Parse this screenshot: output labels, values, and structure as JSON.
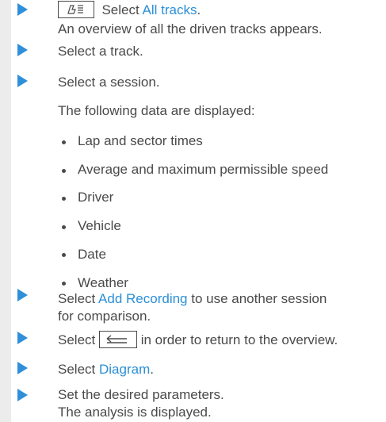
{
  "steps": {
    "s1": {
      "pre": "Select ",
      "link": "All tracks",
      "post": "."
    },
    "s1_result": "An overview of all the driven tracks appears.",
    "s2": "Select a track.",
    "s3": "Select a session.",
    "s3_result": "The following data are displayed:",
    "bullets": [
      "Lap and sector times",
      "Average and maximum permissible speed",
      "Driver",
      "Vehicle",
      "Date",
      "Weather"
    ],
    "s4": {
      "pre": "Select ",
      "link": "Add Recording",
      "post": " to use another session",
      "line2": "for comparison."
    },
    "s5": {
      "pre": "Select ",
      "post": " in order to return to the overview."
    },
    "s6": {
      "pre": "Select ",
      "link": "Diagram",
      "post": "."
    },
    "s7": "Set the desired parameters.",
    "s7_result": "The analysis is displayed."
  },
  "icons": {
    "tracks_button": "track-list-icon",
    "back_button": "back-arrow-icon"
  },
  "colors": {
    "arrow": "#2f8fd9",
    "link": "#2a8fd6",
    "text": "#4a4a4a",
    "sidebar": "#ececec"
  }
}
